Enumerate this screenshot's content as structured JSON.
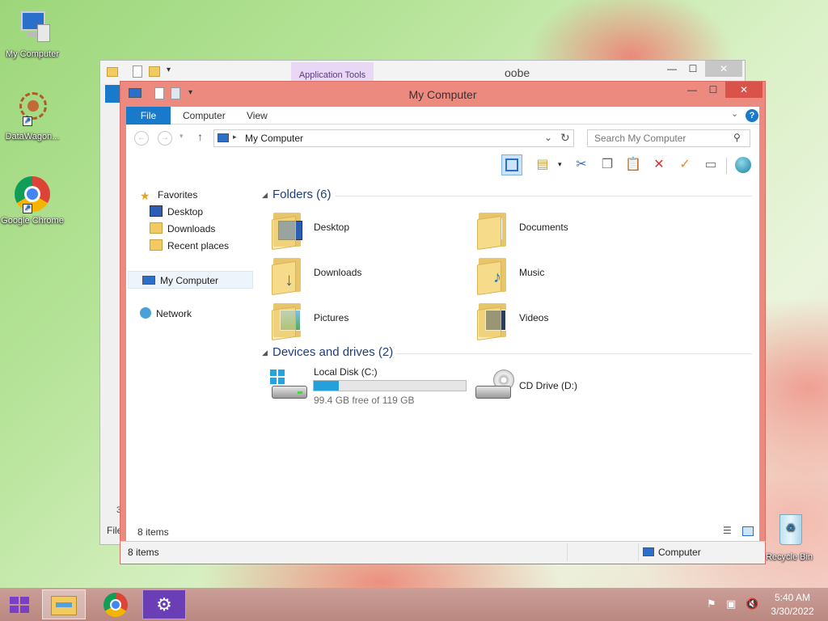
{
  "desktop": {
    "icons": [
      {
        "label": "My Computer"
      },
      {
        "label": "DataWagon..."
      },
      {
        "label": "Google Chrome"
      },
      {
        "label": "Recycle Bin"
      }
    ]
  },
  "back_window": {
    "title": "oobe",
    "context_tab": "Application Tools",
    "status_fragment": "File",
    "side_fragment": "3"
  },
  "window": {
    "title": "My Computer",
    "minimize": "—",
    "maximize": "☐",
    "close": "✕",
    "ribbon_tabs": [
      "File",
      "Computer",
      "View"
    ],
    "address": "My Computer",
    "search_placeholder": "Search My Computer",
    "nav": {
      "favorites": "Favorites",
      "desktop": "Desktop",
      "downloads": "Downloads",
      "recent": "Recent places",
      "computer": "My Computer",
      "network": "Network"
    },
    "folders_header": "Folders (6)",
    "folders": [
      {
        "label": "Desktop"
      },
      {
        "label": "Documents"
      },
      {
        "label": "Downloads"
      },
      {
        "label": "Music"
      },
      {
        "label": "Pictures"
      },
      {
        "label": "Videos"
      }
    ],
    "devices_header": "Devices and drives (2)",
    "drives": {
      "local_label": "Local Disk (C:)",
      "local_free": "99.4 GB free of 119 GB",
      "local_used_fraction": 0.165,
      "cd_label": "CD Drive (D:)"
    },
    "inner_status": "8 items",
    "status_left": "8 items",
    "status_right": "Computer"
  },
  "taskbar": {
    "time": "5:40 AM",
    "date": "3/30/2022"
  }
}
